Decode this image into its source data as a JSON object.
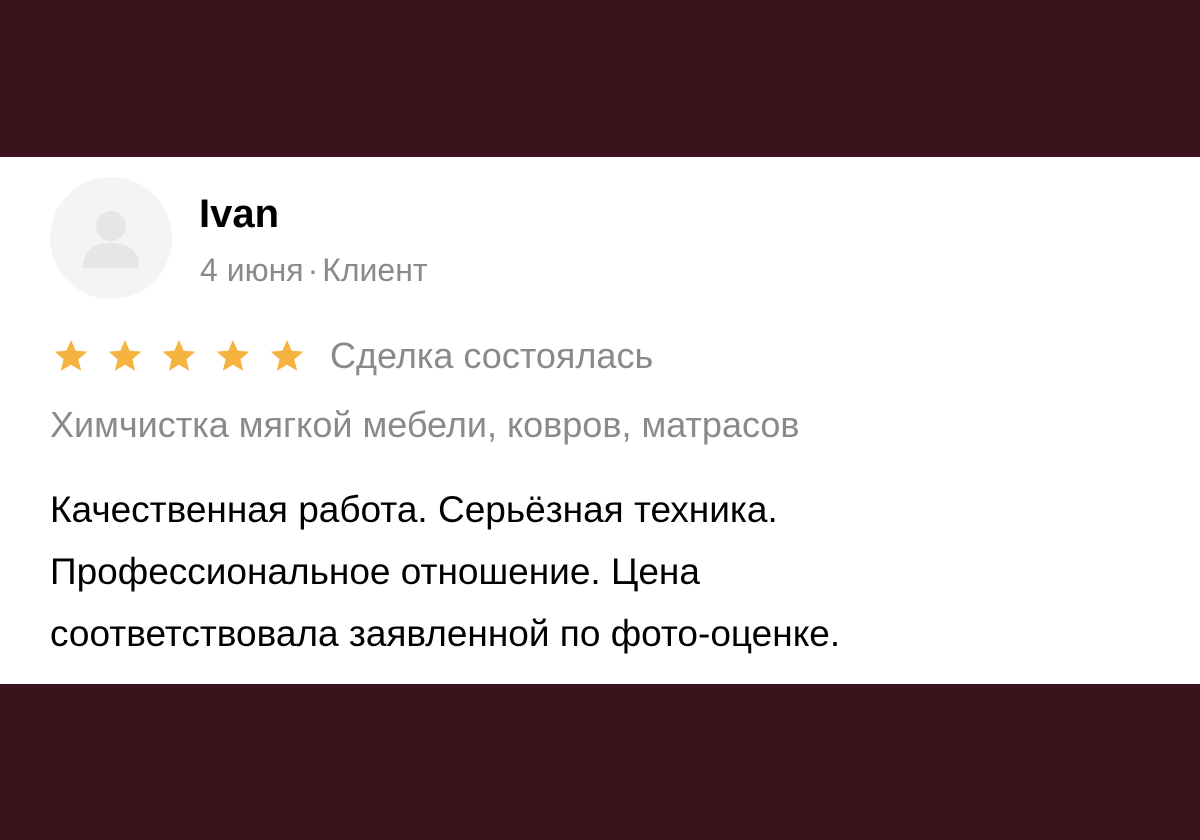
{
  "review": {
    "author": "Ivan",
    "date": "4 июня",
    "separator": "·",
    "role": "Клиент",
    "rating": 5,
    "rating_max": 5,
    "deal_status": "Сделка состоялась",
    "service": "Химчистка мягкой мебели, ковров, матрасов",
    "text_lines": [
      "Качественная работа. Серьёзная техника.",
      "Профессиональное отношение. Цена",
      "соответствовала заявленной по фото-оценке."
    ]
  },
  "icons": {
    "avatar": "user-placeholder-icon",
    "star": "star-icon"
  },
  "colors": {
    "background": "#3a131d",
    "card": "#ffffff",
    "star": "#f5b340",
    "muted_text": "#8a8a8a",
    "avatar_bg": "#f4f4f4",
    "avatar_glyph": "#e6e6e6"
  }
}
